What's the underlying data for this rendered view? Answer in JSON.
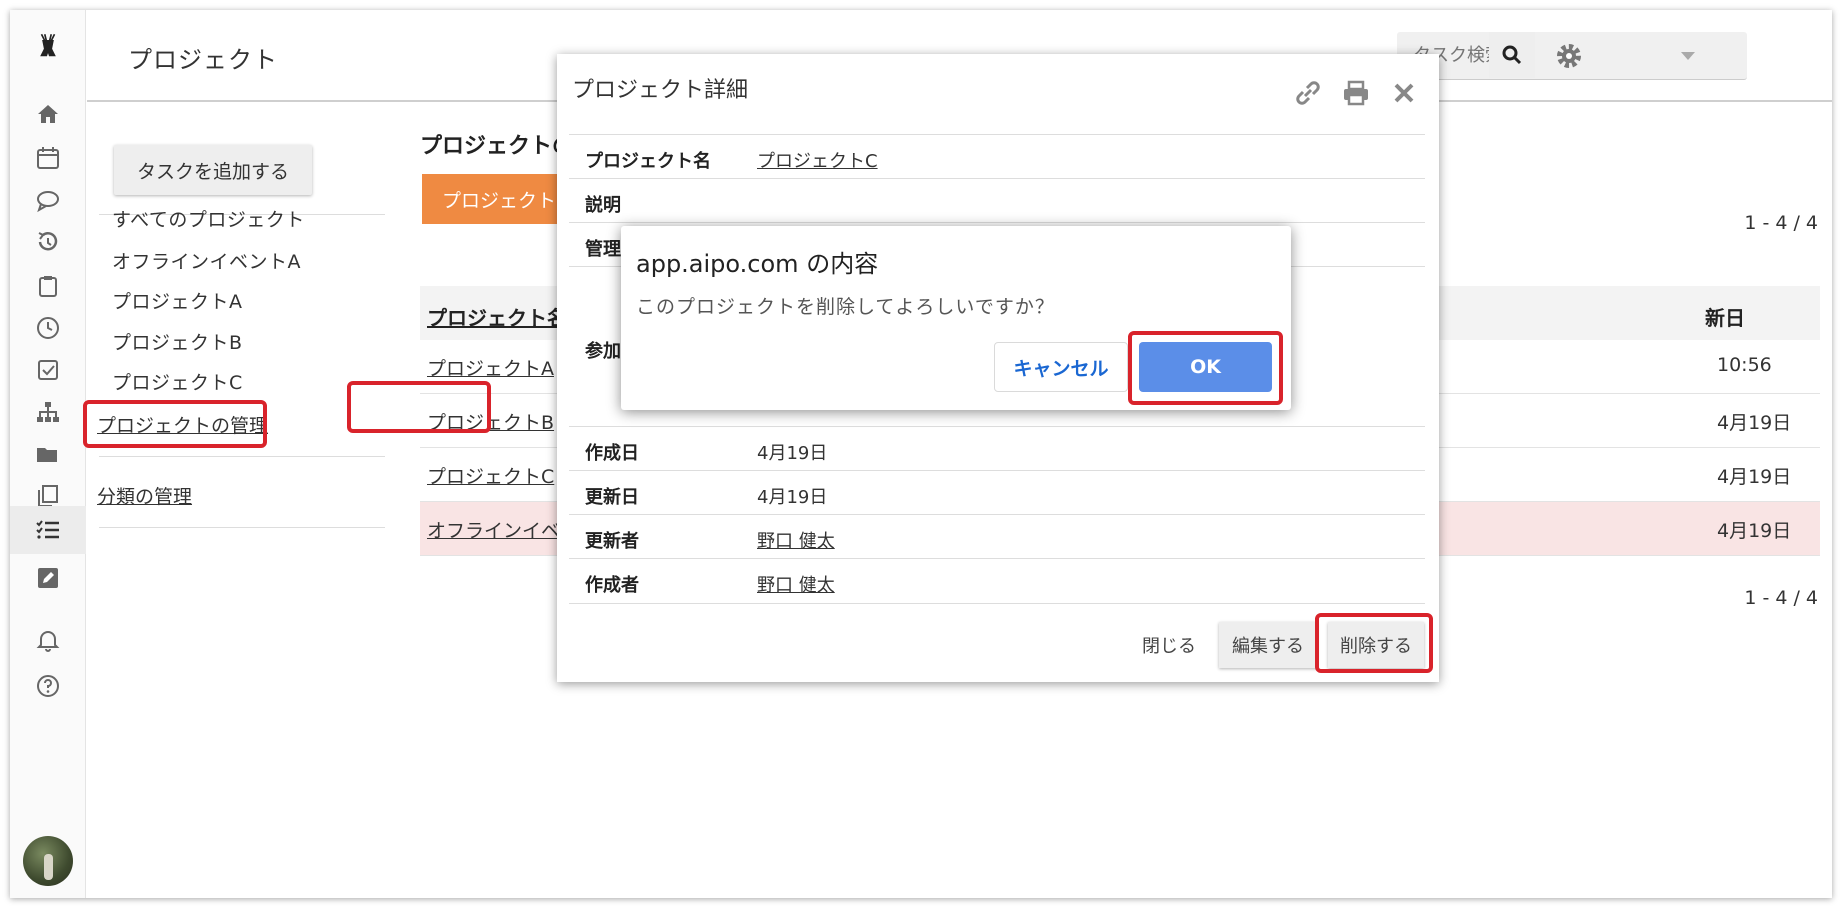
{
  "header": {
    "title": "プロジェクト",
    "search_placeholder": "タスク検索"
  },
  "icons": {
    "logo": "deer-logo-icon",
    "rail": [
      "home-icon",
      "calendar-icon",
      "chat-icon",
      "history-icon",
      "clipboard-icon",
      "clock-icon",
      "checkbox-icon",
      "org-chart-icon",
      "folder-icon",
      "copy-icon",
      "task-list-icon",
      "edit-icon",
      "bell-icon",
      "help-icon"
    ],
    "search": "search-icon",
    "settings": "gear-icon"
  },
  "nav": {
    "add_task": "タスクを追加する",
    "items": [
      "すべてのプロジェクト",
      "オフラインイベントA",
      "プロジェクトA",
      "プロジェクトB",
      "プロジェクトC"
    ],
    "manage_projects": "プロジェクトの管理",
    "manage_categories": "分類の管理"
  },
  "main": {
    "heading": "プロジェクトの管理",
    "add_project": "プロジェクトを追加する",
    "pager_top": "1 - 4 / 4",
    "pager_bottom": "1 - 4 / 4",
    "columns": {
      "name": "プロジェクト名",
      "updated": "新日"
    },
    "rows": [
      {
        "name": "プロジェクトA",
        "updated": "10:56"
      },
      {
        "name": "プロジェクトB",
        "updated": "4月19日"
      },
      {
        "name": "プロジェクトC",
        "updated": "4月19日"
      },
      {
        "name": "オフラインイベントA",
        "updated": "4月19日"
      }
    ]
  },
  "detail": {
    "title": "プロジェクト詳細",
    "fields": {
      "name_label": "プロジェクト名",
      "name_value": "プロジェクトC",
      "desc_label": "説明",
      "admin_label": "管理者",
      "members_label": "参加者",
      "created_label": "作成日",
      "created_value": "4月19日",
      "updated_label": "更新日",
      "updated_value": "4月19日",
      "updated_by_label": "更新者",
      "updated_by_value": "野口 健太",
      "creator_label": "作成者",
      "creator_value": "野口 健太"
    },
    "buttons": {
      "close": "閉じる",
      "edit": "編集する",
      "delete": "削除する"
    }
  },
  "confirm": {
    "title": "app.aipo.com の内容",
    "message": "このプロジェクトを削除してよろしいですか？",
    "cancel": "キャンセル",
    "ok": "OK"
  },
  "colors": {
    "accent_orange": "#ef8a42",
    "ok_blue": "#5b8ee8",
    "highlight_red": "#d9232b",
    "row_highlight": "#f9e4e4"
  }
}
